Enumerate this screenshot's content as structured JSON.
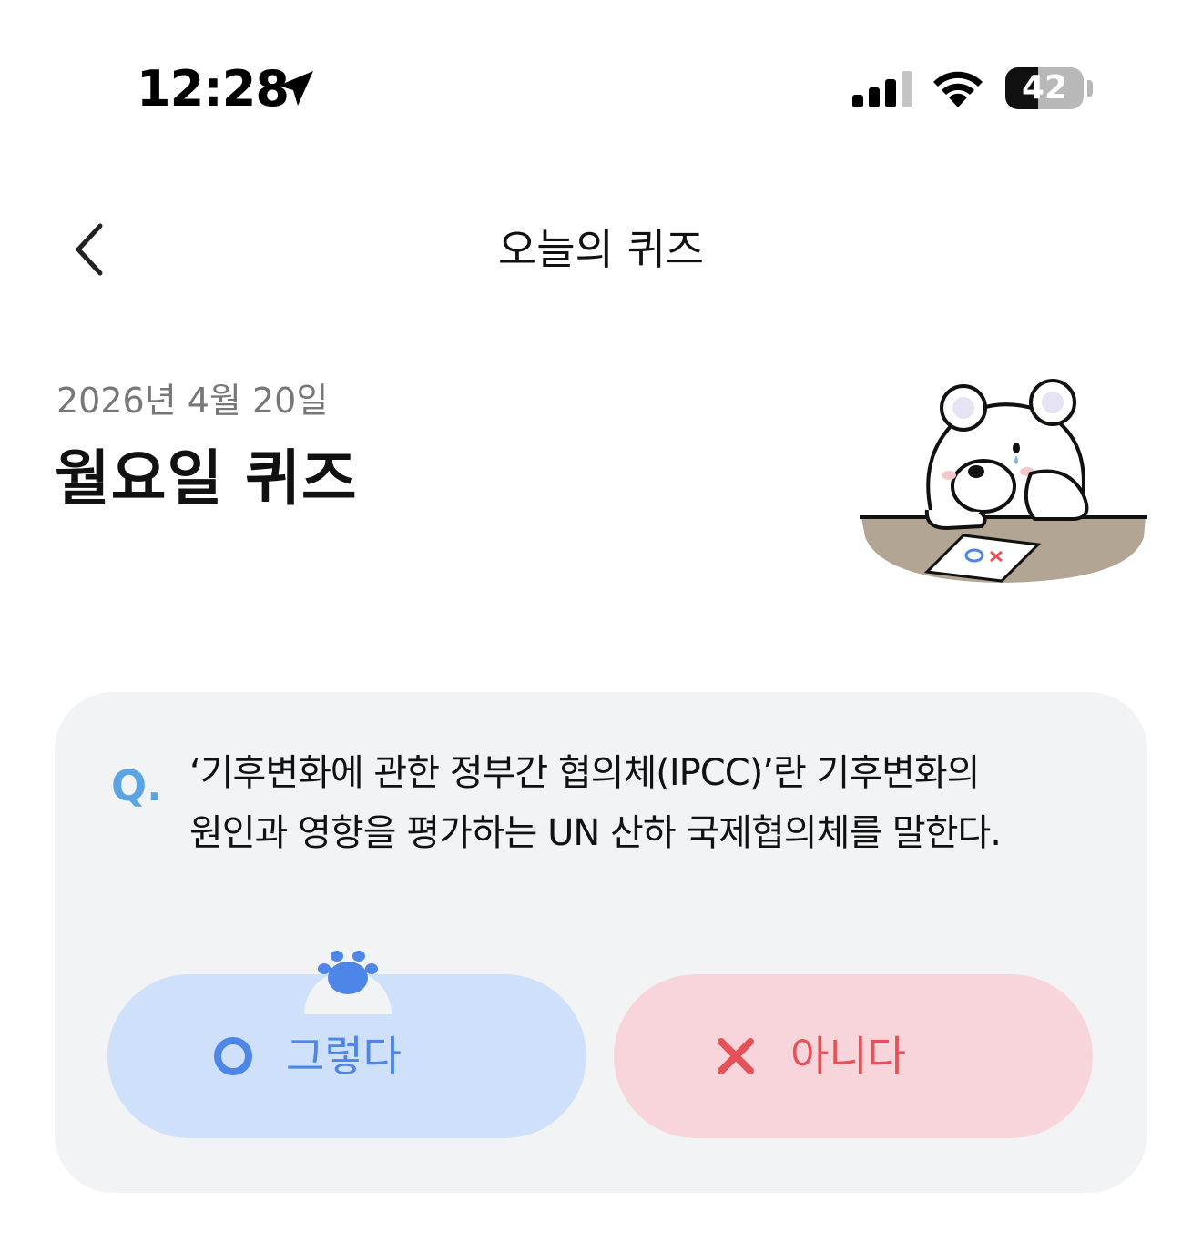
{
  "status_bar": {
    "time": "12:28",
    "battery_level": "42",
    "battery_fraction": 0.42,
    "icons": [
      "location-arrow-icon",
      "cellular-signal-icon",
      "wifi-icon",
      "battery-icon"
    ]
  },
  "nav": {
    "back_icon": "chevron-left-icon",
    "title": "오늘의 퀴즈"
  },
  "header": {
    "date": "2026년 4월 20일",
    "title": "월요일 퀴즈",
    "illustration": "bear-with-ox-quiz-paper"
  },
  "quiz": {
    "q_mark": "Q.",
    "question_line1": "‘기후변화에 관한 정부간 협의체(IPCC)’란 기후변화의",
    "question_line2": "원인과 영향을 평가하는 UN 산하 국제협의체를 말한다.",
    "answers": [
      {
        "label": "그렇다",
        "icon": "circle-o-icon",
        "color": "#4d86e6",
        "bg": "#cfe0fa"
      },
      {
        "label": "아니다",
        "icon": "x-mark-icon",
        "color": "#e45359",
        "bg": "#f8d5da"
      }
    ],
    "selected_marker_icon": "paw-icon"
  },
  "colors": {
    "q_accent": "#5aa4e3",
    "card_bg": "#f2f3f5",
    "date_gray": "#777777"
  }
}
